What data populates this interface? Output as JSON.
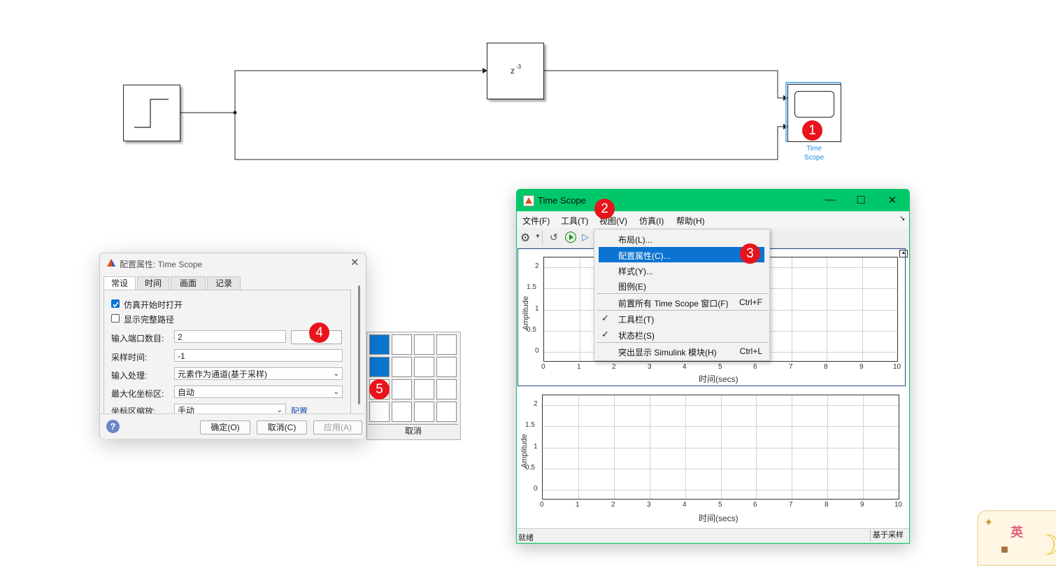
{
  "canvas": {
    "delay_block_label": "z",
    "delay_block_exp": "-3",
    "scope_block_label_line1": "Time",
    "scope_block_label_line2": "Scope"
  },
  "markers": [
    "1",
    "2",
    "3",
    "4",
    "5"
  ],
  "time_scope": {
    "title": "Time Scope",
    "menus": [
      "文件(F)",
      "工具(T)",
      "视图(V)",
      "仿真(I)",
      "帮助(H)"
    ],
    "view_menu": {
      "items": [
        {
          "label": "布局(L)...",
          "shortcut": "",
          "checked": false
        },
        {
          "label": "配置属性(C)...",
          "shortcut": "",
          "checked": false,
          "highlighted": true
        },
        {
          "label": "样式(Y)...",
          "shortcut": "",
          "checked": false
        },
        {
          "label": "图例(E)",
          "shortcut": "",
          "checked": false
        },
        {
          "label": "前置所有 Time Scope 窗口(F)",
          "shortcut": "Ctrl+F",
          "checked": false
        },
        {
          "label": "工具栏(T)",
          "shortcut": "",
          "checked": true
        },
        {
          "label": "状态栏(S)",
          "shortcut": "",
          "checked": true
        },
        {
          "label": "突出显示 Simulink 模块(H)",
          "shortcut": "Ctrl+L",
          "checked": false
        }
      ]
    },
    "plots": [
      {
        "ylabel": "Amplitude",
        "xlabel": "时间(secs)",
        "xticks": [
          "0",
          "1",
          "2",
          "3",
          "4",
          "5",
          "6",
          "7",
          "8",
          "9",
          "10"
        ],
        "yticks": [
          "2",
          "1.5",
          "1",
          "0.5",
          "0"
        ]
      },
      {
        "ylabel": "Amplitude",
        "xlabel": "时间(secs)",
        "xticks": [
          "0",
          "1",
          "2",
          "3",
          "4",
          "5",
          "6",
          "7",
          "8",
          "9",
          "10"
        ],
        "yticks": [
          "2",
          "1.5",
          "1",
          "0.5",
          "0"
        ]
      }
    ],
    "status_left": "就绪",
    "status_right": "基于采样"
  },
  "config_dialog": {
    "title": "配置属性: Time Scope",
    "tabs": [
      "常设",
      "时间",
      "画面",
      "记录"
    ],
    "open_at_start_label": "仿真开始时打开",
    "open_at_start_checked": true,
    "show_full_path_label": "显示完整路径",
    "show_full_path_checked": false,
    "input_ports_label": "输入端口数目:",
    "input_ports_value": "2",
    "layout_button": "布",
    "sample_time_label": "采样时间:",
    "sample_time_value": "-1",
    "input_processing_label": "输入处理:",
    "input_processing_value": "元素作为通道(基于采样)",
    "maximize_axes_label": "最大化坐标区:",
    "maximize_axes_value": "自动",
    "axes_scaling_label": "坐标区缩放:",
    "axes_scaling_value": "手动",
    "configure_link": "配置",
    "ok_button": "确定(O)",
    "cancel_button": "取消(C)",
    "apply_button": "应用(A)"
  },
  "layout_popup": {
    "cancel_label": "取消",
    "selected_cells": [
      [
        0,
        0
      ],
      [
        1,
        0
      ]
    ]
  },
  "ime_indicator": "英"
}
